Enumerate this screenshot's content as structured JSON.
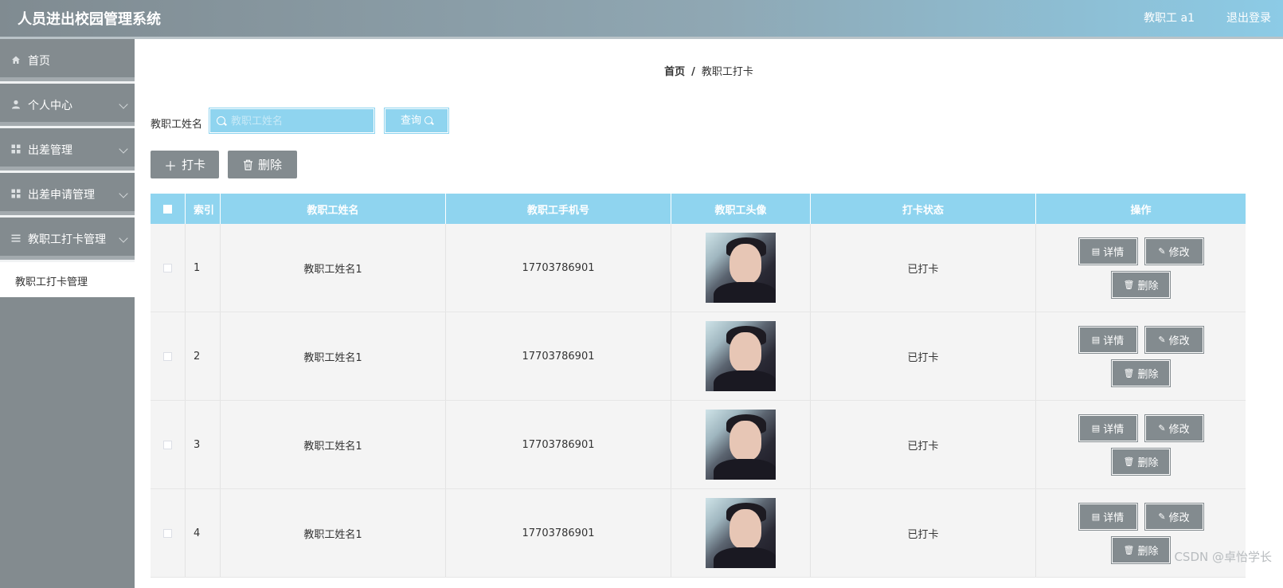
{
  "header": {
    "title": "人员进出校园管理系统",
    "user": "教职工 a1",
    "logout": "退出登录"
  },
  "sidebar": {
    "items": [
      {
        "label": "首页",
        "icon": "home-icon"
      },
      {
        "label": "个人中心",
        "icon": "user-icon"
      },
      {
        "label": "出差管理",
        "icon": "grid-icon"
      },
      {
        "label": "出差申请管理",
        "icon": "grid-icon"
      },
      {
        "label": "教职工打卡管理",
        "icon": "list-icon"
      }
    ],
    "submenu": {
      "label": "教职工打卡管理"
    }
  },
  "breadcrumb": {
    "home": "首页",
    "separator": "/",
    "current": "教职工打卡"
  },
  "search": {
    "label": "教职工姓名",
    "placeholder": "教职工姓名",
    "button": "查询"
  },
  "actions": {
    "add": "打卡",
    "delete": "删除"
  },
  "table": {
    "columns": [
      "索引",
      "教职工姓名",
      "教职工手机号",
      "教职工头像",
      "打卡状态",
      "操作"
    ],
    "rows": [
      {
        "index": "1",
        "name": "教职工姓名1",
        "phone": "17703786901",
        "status": "已打卡"
      },
      {
        "index": "2",
        "name": "教职工姓名1",
        "phone": "17703786901",
        "status": "已打卡"
      },
      {
        "index": "3",
        "name": "教职工姓名1",
        "phone": "17703786901",
        "status": "已打卡"
      },
      {
        "index": "4",
        "name": "教职工姓名1",
        "phone": "17703786901",
        "status": "已打卡"
      }
    ],
    "row_actions": {
      "detail": "详情",
      "edit": "修改",
      "delete": "删除"
    }
  },
  "watermark": "CSDN @卓怡学长",
  "colors": {
    "accent": "#8fd4ef",
    "sidebar": "#838b8f",
    "button": "#838b8f"
  }
}
